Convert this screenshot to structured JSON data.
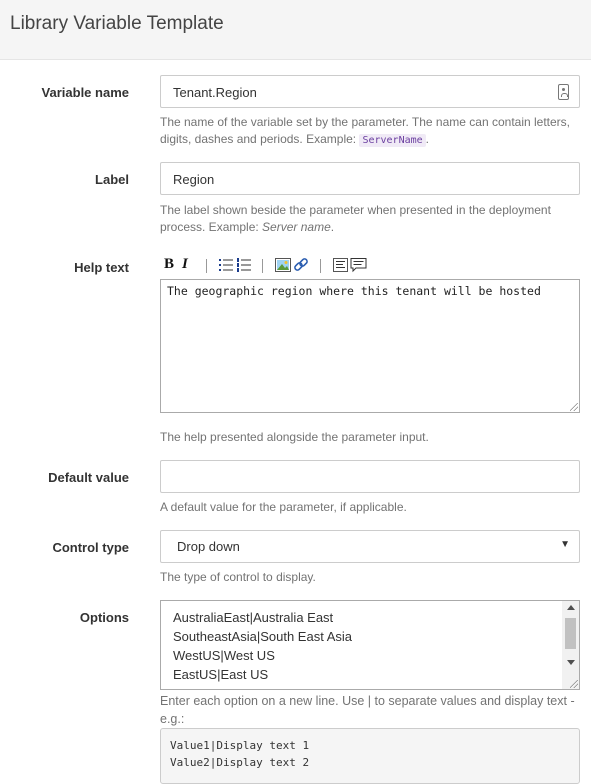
{
  "header": {
    "title": "Library Variable Template"
  },
  "variable_name": {
    "label": "Variable name",
    "value": "Tenant.Region",
    "icon": "contact-card-icon",
    "hint_before": "The name of the variable set by the parameter. The name can contain letters, digits, dashes and periods. Example: ",
    "hint_example": "ServerName",
    "hint_after": "."
  },
  "label_field": {
    "label": "Label",
    "value": "Region",
    "hint_before": "The label shown beside the parameter when presented in the deployment process. Example: ",
    "hint_example": "Server name",
    "hint_after": "."
  },
  "help_text": {
    "label": "Help text",
    "toolbar": {
      "bold": "B",
      "italic": "I"
    },
    "value": "The geographic region where this tenant will be hosted",
    "hint": "The help presented alongside the parameter input."
  },
  "default_value": {
    "label": "Default value",
    "value": "",
    "hint": "A default value for the parameter, if applicable."
  },
  "control_type": {
    "label": "Control type",
    "selected": "Drop down",
    "hint": "The type of control to display."
  },
  "options": {
    "label": "Options",
    "lines": [
      "AustraliaEast|Australia East",
      "SoutheastAsia|South East Asia",
      "WestUS|West US",
      "EastUS|East US"
    ],
    "hint": "Enter each option on a new line. Use | to separate values and display text - e.g.:",
    "example_lines": [
      "Value1|Display text 1",
      "Value2|Display text 2"
    ]
  }
}
